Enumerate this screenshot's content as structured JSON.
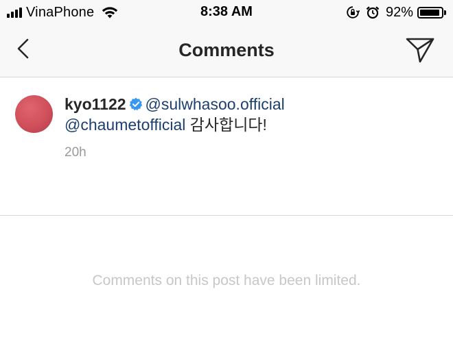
{
  "status_bar": {
    "carrier": "VinaPhone",
    "time": "8:38 AM",
    "battery_percent": "92%",
    "battery_level": 0.92,
    "icons": [
      "signal-bars-icon",
      "wifi-icon",
      "orientation-lock-icon",
      "alarm-icon",
      "battery-icon"
    ]
  },
  "header": {
    "title": "Comments",
    "back_icon": "chevron-left-icon",
    "send_icon": "paper-plane-icon"
  },
  "comment": {
    "username": "kyo1122",
    "verified": true,
    "mention_1": "@sulwhasoo.official",
    "mention_2": "@chaumetofficial",
    "text": "감사합니다!",
    "time_ago": "20h",
    "avatar_color": "#cf4f5b"
  },
  "notice": "Comments on this post have been limited.",
  "colors": {
    "mention": "#1c3f6e",
    "verified_badge": "#3897f0",
    "muted": "#999999",
    "notice": "#c7c7c7"
  }
}
